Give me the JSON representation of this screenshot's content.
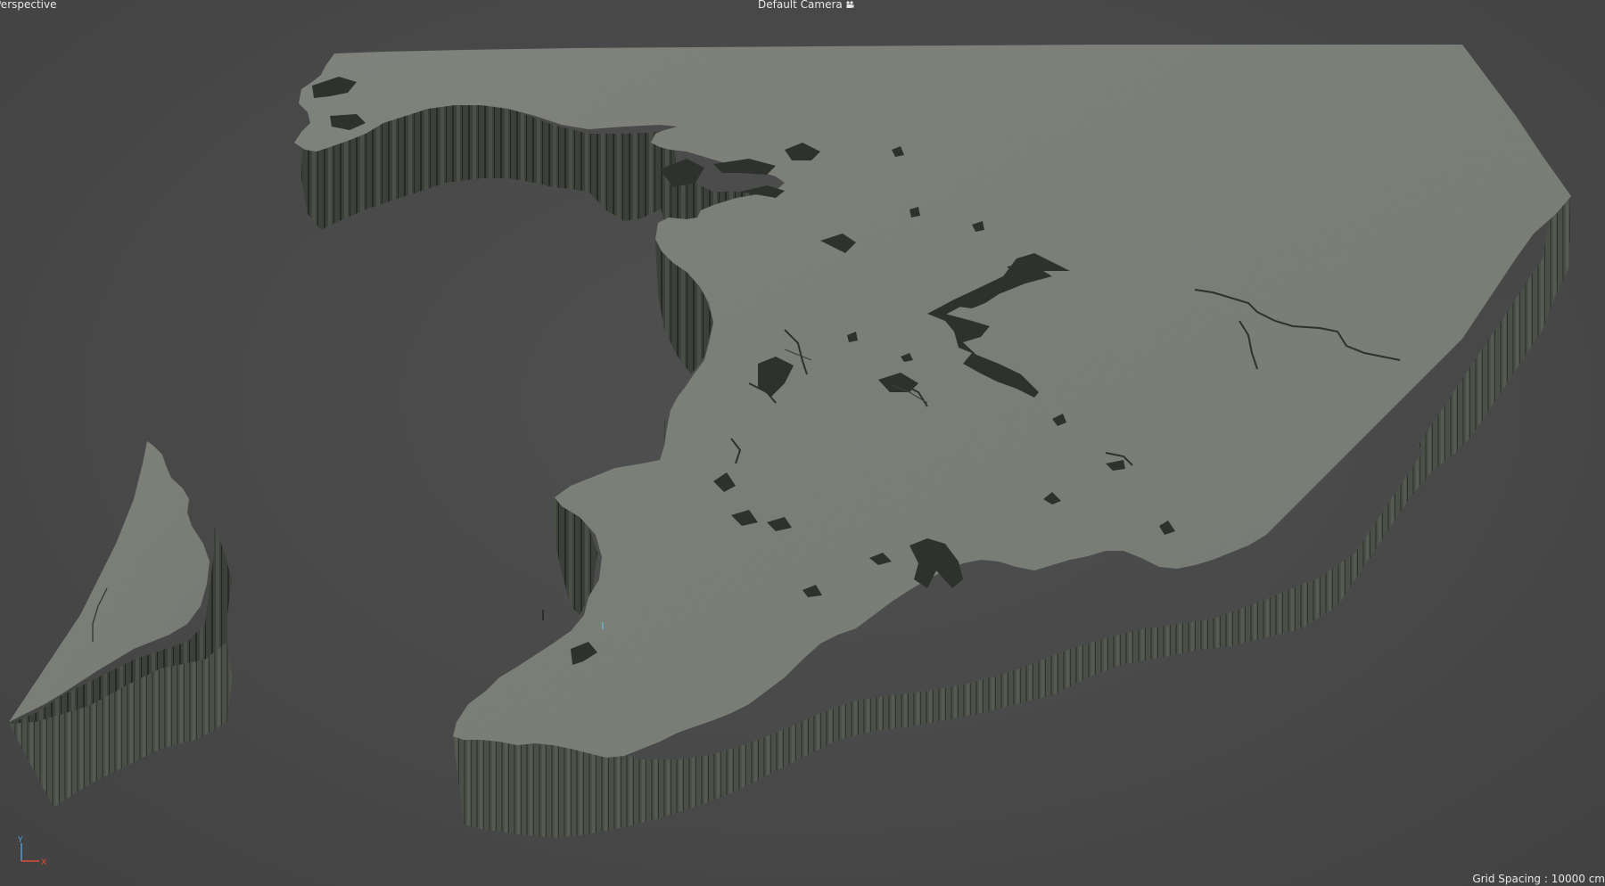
{
  "viewport": {
    "view_mode": "Perspective",
    "camera": "Default Camera",
    "camera_icon": "camera-icon",
    "grid_spacing": "Grid Spacing : 10000 cm"
  },
  "axis_gizmo": {
    "y_label": "Y",
    "x_label": "X",
    "y_color": "#4fa3e0",
    "x_color": "#e04a3a"
  },
  "colors": {
    "background": "#4a4a4a",
    "terrain_top": "#7d817a",
    "terrain_side": "#4c5149",
    "terrain_side_dark": "#2f322d",
    "water": "#2e322d"
  }
}
